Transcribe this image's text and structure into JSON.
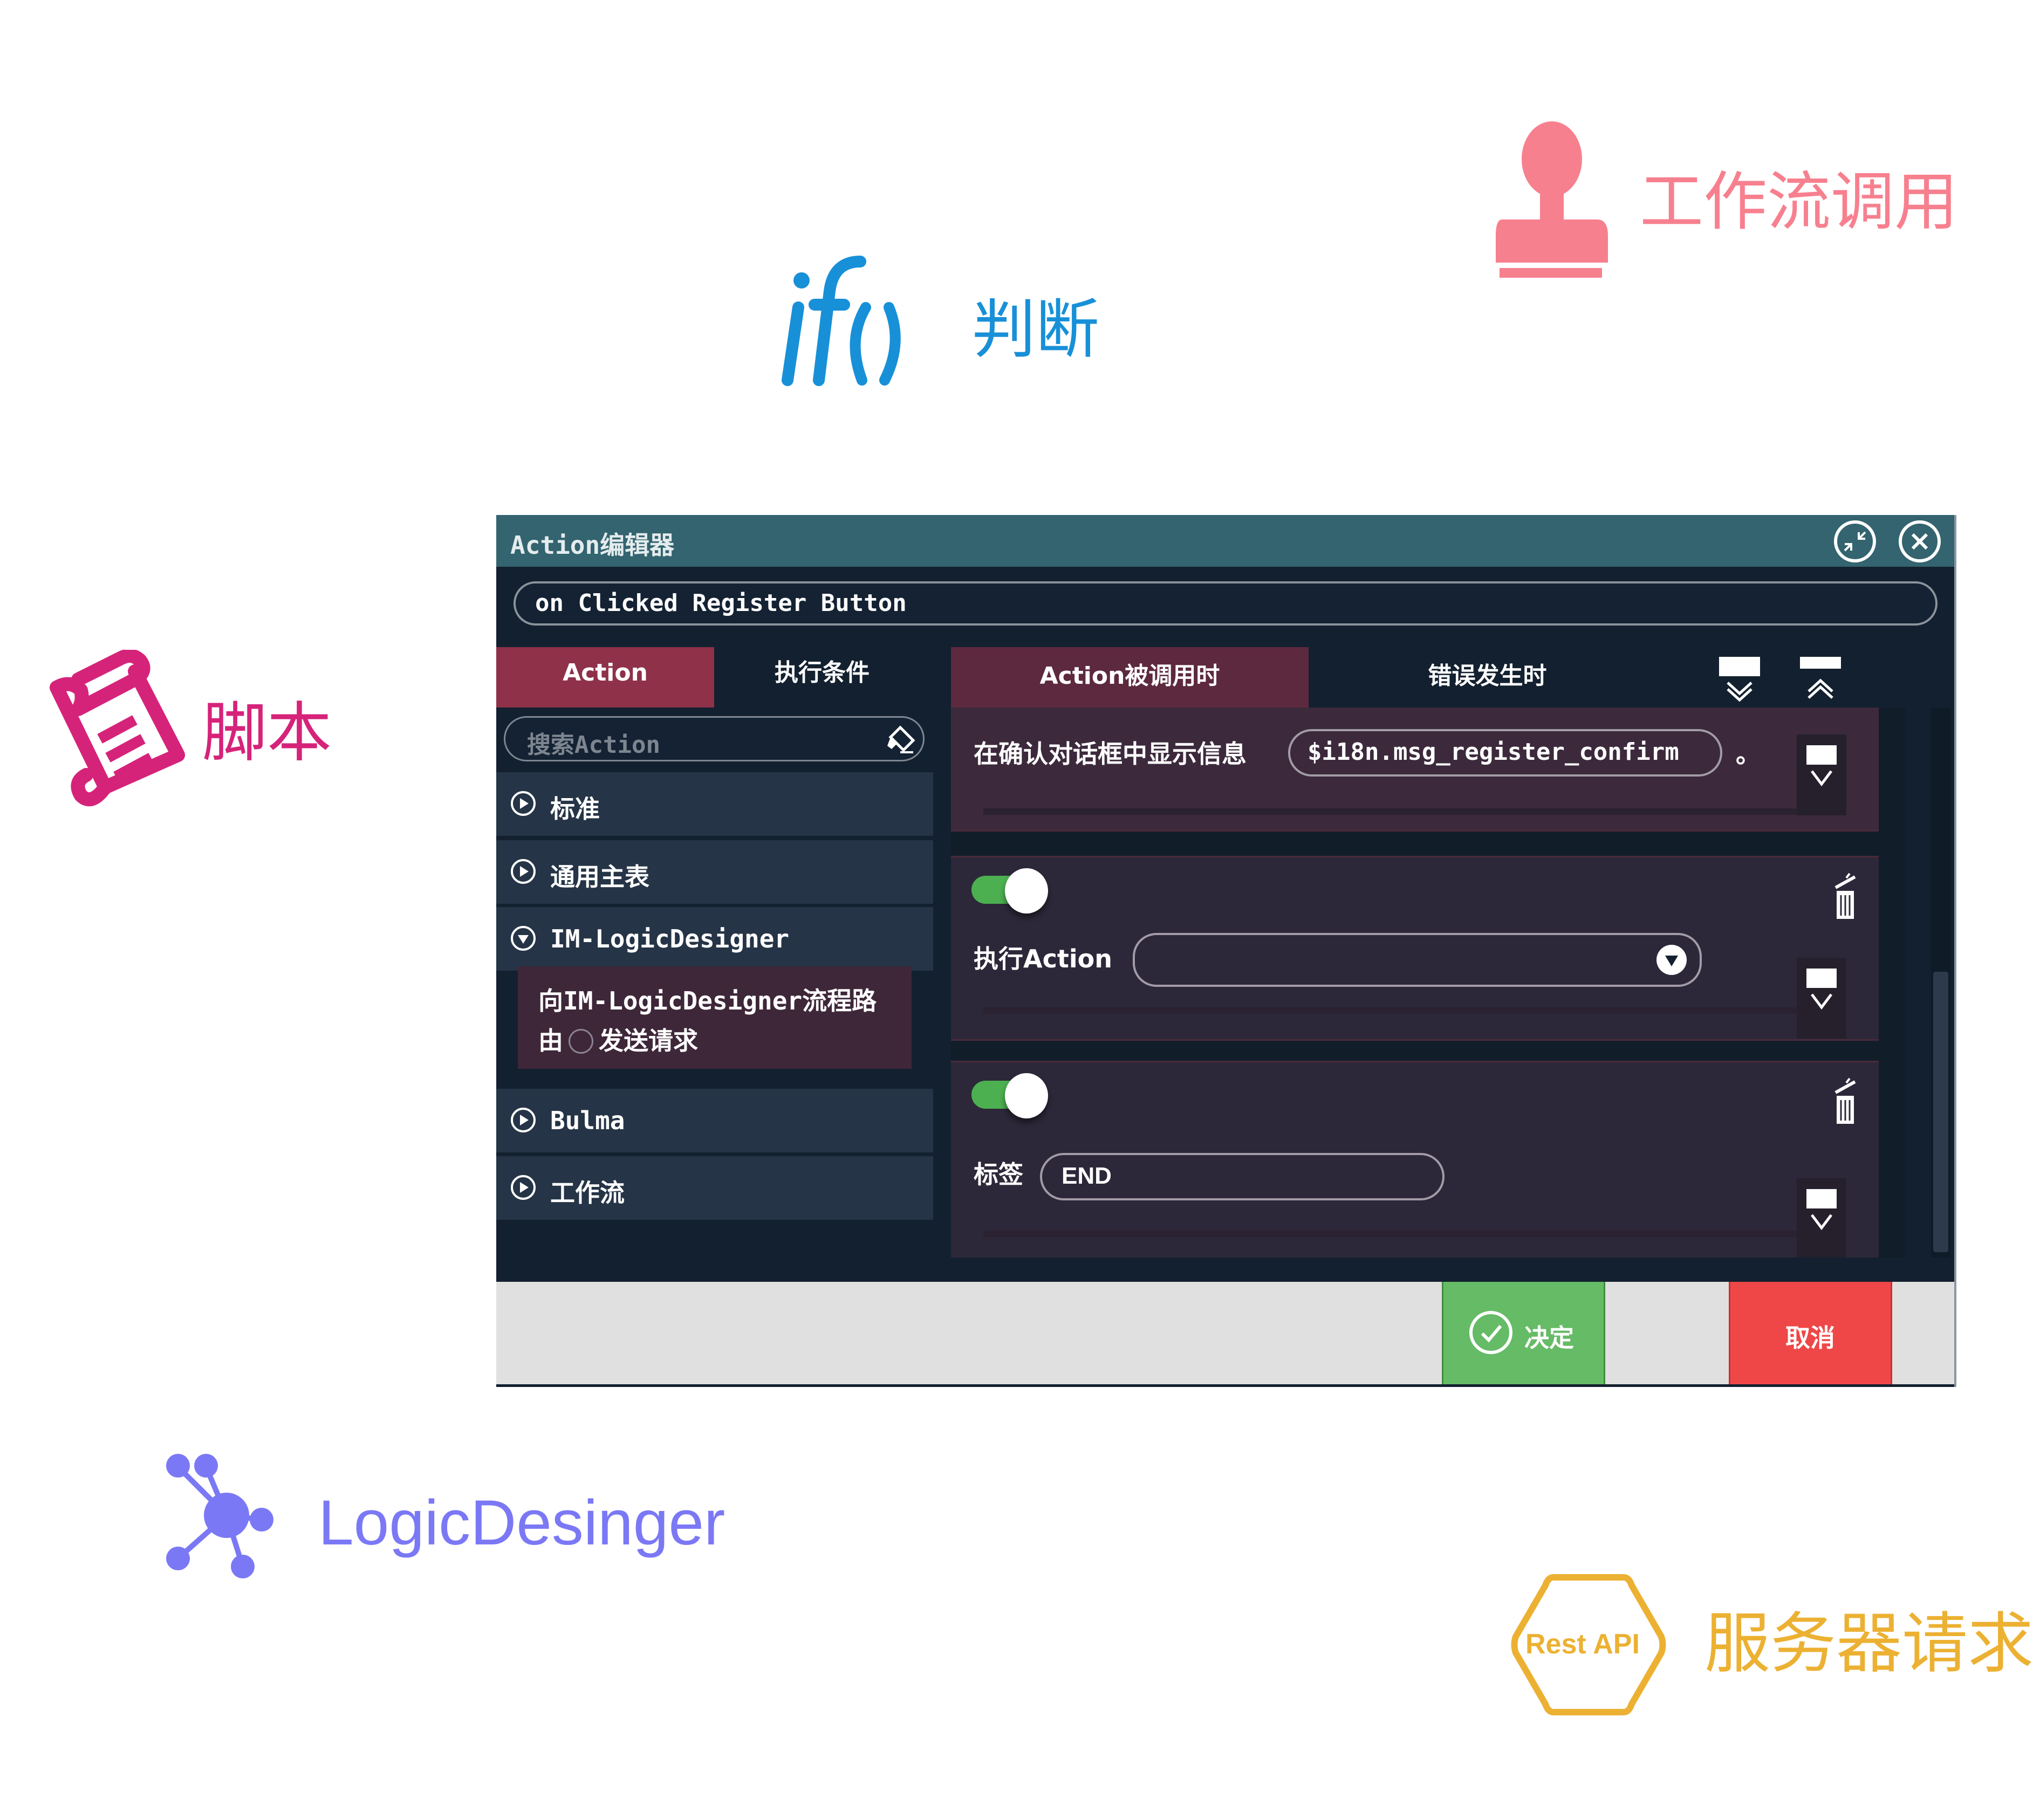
{
  "legend": {
    "workflow_call": {
      "label": "工作流调用",
      "icon": "stamp-icon",
      "color": "#f7808f"
    },
    "condition": {
      "label": "判断",
      "icon": "if-icon",
      "glyph": "if()",
      "color": "#1890d8"
    },
    "script": {
      "label": "脚本",
      "icon": "scroll-icon",
      "color": "#d6237a"
    },
    "logic_designer": {
      "label": "LogicDesinger",
      "icon": "network-icon",
      "color": "#7b78f5"
    },
    "server_request": {
      "label": "服务器请求",
      "icon": "rest-api-hexagon-icon",
      "badge": "Rest API",
      "color": "#ecb132"
    }
  },
  "window": {
    "title": "Action编辑器",
    "event_name": "on Clicked Register Button",
    "tabs_left": [
      {
        "label": "Action",
        "active": true
      },
      {
        "label": "执行条件",
        "active": false
      }
    ],
    "tabs_right": [
      {
        "label": "Action被调用时",
        "active": true
      },
      {
        "label": "错误发生时",
        "active": false
      }
    ],
    "search": {
      "placeholder": "搜索Action"
    },
    "categories": [
      {
        "label": "标准",
        "expanded": false
      },
      {
        "label": "通用主表",
        "expanded": false
      },
      {
        "label": "IM-LogicDesigner",
        "expanded": true
      },
      {
        "label": "Bulma",
        "expanded": false
      },
      {
        "label": "工作流",
        "expanded": false
      }
    ],
    "sub_item": {
      "line1": "向IM-LogicDesigner流程路",
      "line2_pre": "由",
      "line2_post": "发送请求"
    },
    "cards": [
      {
        "label": "在确认对话框中显示信息",
        "value": "$i18n.msg_register_confirm",
        "suffix": "。"
      },
      {
        "enabled": true,
        "label": "执行Action",
        "value": ""
      },
      {
        "enabled": true,
        "label": "标签",
        "value": "END"
      }
    ],
    "footer": {
      "ok_label": "决定",
      "cancel_label": "取消"
    },
    "colors": {
      "titlebar": "#33646f",
      "tab_active": "#8e3149",
      "ok": "#66bb66",
      "cancel": "#ef4747",
      "toggle_on": "#4caf50"
    }
  }
}
